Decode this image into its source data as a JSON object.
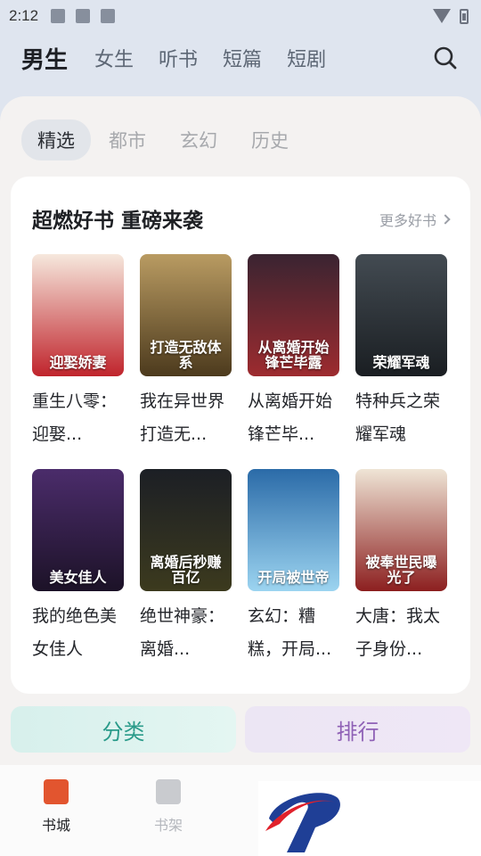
{
  "status": {
    "time": "2:12"
  },
  "top_tabs": [
    "男生",
    "女生",
    "听书",
    "短篇",
    "短剧"
  ],
  "sub_tabs": [
    "精选",
    "都市",
    "玄幻",
    "历史"
  ],
  "section": {
    "title": "超燃好书 重磅来袭",
    "more": "更多好书"
  },
  "books": [
    {
      "name": "重生八零：迎娶...",
      "cover_text": "迎娶娇妻",
      "cover_colors": [
        "#f6e8dd",
        "#c0242c"
      ]
    },
    {
      "name": "我在异世界打造无...",
      "cover_text": "打造无敌体系",
      "cover_colors": [
        "#b99b62",
        "#4c3a1d"
      ]
    },
    {
      "name": "从离婚开始锋芒毕...",
      "cover_text": "从离婚开始锋芒毕露",
      "cover_colors": [
        "#3a2431",
        "#9d2b2f"
      ]
    },
    {
      "name": "特种兵之荣耀军魂",
      "cover_text": "荣耀军魂",
      "cover_colors": [
        "#434b52",
        "#1a1e22"
      ]
    },
    {
      "name": "我的绝色美女佳人",
      "cover_text": "美女佳人",
      "cover_colors": [
        "#4b2c6b",
        "#1c1227"
      ]
    },
    {
      "name": "绝世神豪：离婚...",
      "cover_text": "离婚后秒赚百亿",
      "cover_colors": [
        "#1c1f25",
        "#3c3a1e"
      ]
    },
    {
      "name": "玄幻：糟糕，开局...",
      "cover_text": "开局被世帝",
      "cover_colors": [
        "#2b6ba8",
        "#9cd4f0"
      ]
    },
    {
      "name": "大唐：我太子身份...",
      "cover_text": "被奉世民曝光了",
      "cover_colors": [
        "#efe5d6",
        "#8c1f1f"
      ]
    }
  ],
  "buttons": {
    "category": "分类",
    "ranking": "排行"
  },
  "nav": [
    {
      "label": "书城",
      "active": true
    },
    {
      "label": "书架",
      "active": false
    }
  ]
}
